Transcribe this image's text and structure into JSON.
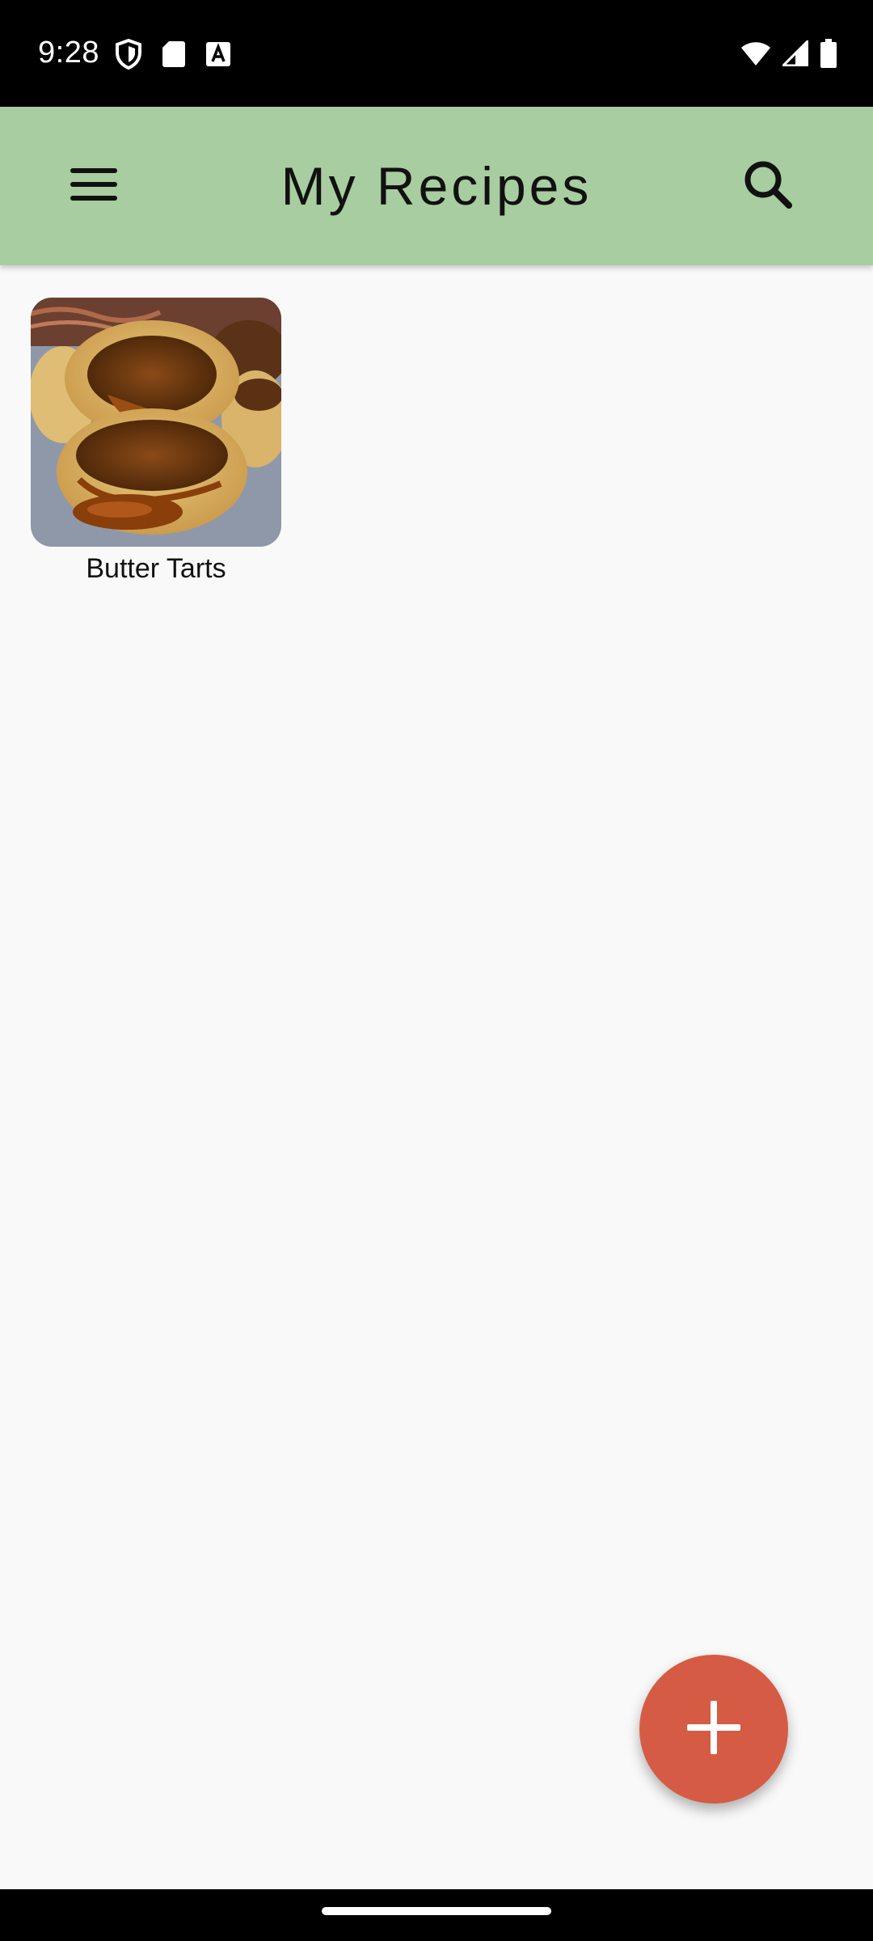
{
  "status_bar": {
    "time": "9:28",
    "left_icons": [
      "shield-icon",
      "sd-card-icon",
      "text-a-icon"
    ],
    "right_icons": [
      "wifi-icon",
      "cell-signal-icon",
      "battery-icon"
    ]
  },
  "app_bar": {
    "title": "My Recipes",
    "background_color": "#a8cda0",
    "menu_icon": "hamburger-menu-icon",
    "search_icon": "search-icon"
  },
  "recipes": [
    {
      "label": "Butter Tarts",
      "image": "butter-tarts-photo"
    }
  ],
  "fab": {
    "icon": "plus-icon",
    "color": "#d65b44"
  }
}
